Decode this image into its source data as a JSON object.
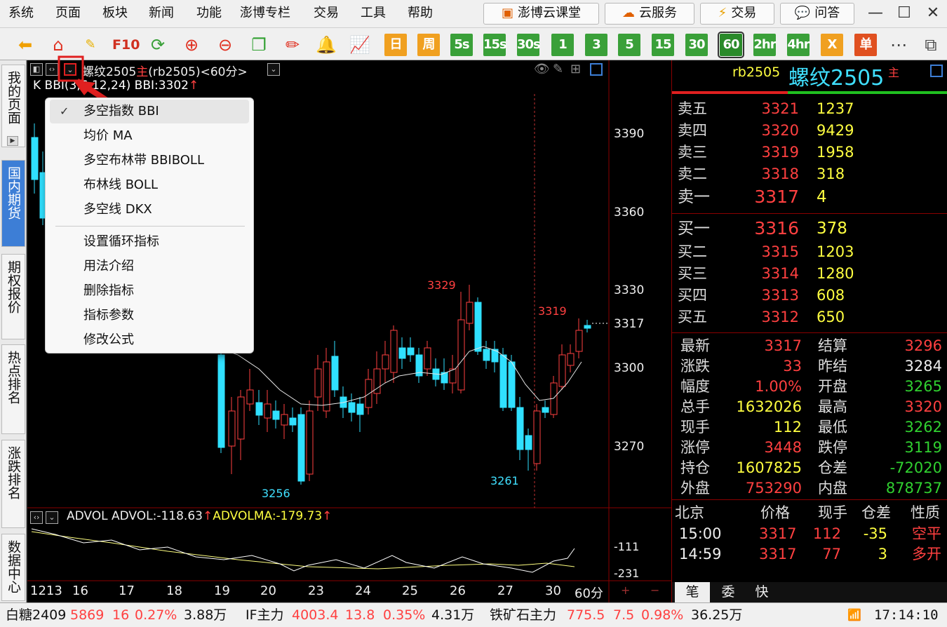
{
  "menubar": {
    "items": [
      "系统",
      "页面",
      "板块",
      "新闻",
      "功能",
      "澎博专栏",
      "交易",
      "工具",
      "帮助"
    ],
    "buttons": [
      "澎博云课堂",
      "云服务",
      "交易",
      "问答"
    ]
  },
  "toolbar": {
    "periods": [
      "日",
      "周",
      "5s",
      "15s",
      "30s",
      "1",
      "3",
      "5",
      "15",
      "30",
      "60",
      "2hr",
      "4hr",
      "X",
      "单"
    ],
    "f10": "F10"
  },
  "left_tabs": [
    "我的页面",
    "国内期货",
    "期权报价",
    "热点排名",
    "涨跌排名",
    "数据中心"
  ],
  "chart": {
    "title": "螺纹2505",
    "main_mark": "主",
    "code": "(rb2505)",
    "period": "<60分>",
    "indicator_line_prefix": "K BBI(3,6,12,24) BBI:3302",
    "indicator_arrow": "↑",
    "price_ticks": [
      "3390",
      "3360",
      "3330",
      "3300",
      "3270"
    ],
    "current_price_tick": "3317",
    "annotations": {
      "high": "3329",
      "high2": "3319",
      "low1": "3256",
      "low2": "3261"
    },
    "date_labels": [
      "1213",
      "16",
      "17",
      "18",
      "19",
      "20",
      "23",
      "24",
      "25",
      "26",
      "27",
      "30"
    ],
    "period_label": "60分",
    "sub_panel": {
      "label_a": "ADVOL ADVOL:-118.63",
      "arrow_a": "↑",
      "label_b": "ADVOLMA:-179.73",
      "arrow_b": "↑",
      "ticks": [
        "-111",
        "-231"
      ]
    }
  },
  "dropdown": {
    "items": [
      "多空指数 BBI",
      "均价 MA",
      "多空布林带 BBIBOLL",
      "布林线 BOLL",
      "多空线 DKX"
    ],
    "items2": [
      "设置循环指标",
      "用法介绍",
      "删除指标",
      "指标参数",
      "修改公式"
    ],
    "check": "✓"
  },
  "quote": {
    "code": "rb2505",
    "name": "螺纹2505",
    "main_mark": "主",
    "asks": [
      {
        "label": "卖五",
        "price": "3321",
        "vol": "1237"
      },
      {
        "label": "卖四",
        "price": "3320",
        "vol": "9429"
      },
      {
        "label": "卖三",
        "price": "3319",
        "vol": "1958"
      },
      {
        "label": "卖二",
        "price": "3318",
        "vol": "318"
      },
      {
        "label": "卖一",
        "price": "3317",
        "vol": "4"
      }
    ],
    "bids": [
      {
        "label": "买一",
        "price": "3316",
        "vol": "378"
      },
      {
        "label": "买二",
        "price": "3315",
        "vol": "1203"
      },
      {
        "label": "买三",
        "price": "3314",
        "vol": "1280"
      },
      {
        "label": "买四",
        "price": "3313",
        "vol": "608"
      },
      {
        "label": "买五",
        "price": "3312",
        "vol": "650"
      }
    ],
    "stats_left": [
      {
        "label": "最新",
        "value": "3317"
      },
      {
        "label": "涨跌",
        "value": "33"
      },
      {
        "label": "幅度",
        "value": "1.00%"
      },
      {
        "label": "总手",
        "value": "1632026"
      },
      {
        "label": "现手",
        "value": "112"
      },
      {
        "label": "涨停",
        "value": "3448"
      },
      {
        "label": "持仓",
        "value": "1607825"
      },
      {
        "label": "外盘",
        "value": "753290"
      }
    ],
    "stats_right": [
      {
        "label": "结算",
        "value": "3296"
      },
      {
        "label": "昨结",
        "value": "3284"
      },
      {
        "label": "开盘",
        "value": "3265"
      },
      {
        "label": "最高",
        "value": "3320"
      },
      {
        "label": "最低",
        "value": "3262"
      },
      {
        "label": "跌停",
        "value": "3119"
      },
      {
        "label": "仓差",
        "value": "-72020"
      },
      {
        "label": "内盘",
        "value": "878737"
      }
    ],
    "ticks_header": [
      "北京",
      "价格",
      "现手",
      "仓差",
      "性质"
    ],
    "ticks": [
      {
        "time": "15:00",
        "price": "3317",
        "vol": "112",
        "oi": "-35",
        "nature": "空平"
      },
      {
        "time": "14:59",
        "price": "3317",
        "vol": "77",
        "oi": "3",
        "nature": "多开"
      }
    ],
    "bottom_tabs": [
      "笔",
      "委",
      "快"
    ]
  },
  "statusbar": {
    "items": [
      {
        "name": "白糖2409",
        "price": "5869",
        "chg": "16",
        "pct": "0.27%",
        "vol": "3.88万"
      },
      {
        "name": "IF主力",
        "price": "4003.4",
        "chg": "13.8",
        "pct": "0.35%",
        "vol": "4.31万"
      },
      {
        "name": "铁矿石主力",
        "price": "775.5",
        "chg": "7.5",
        "pct": "0.98%",
        "vol": "36.25万"
      }
    ],
    "time": "17:14:10"
  },
  "colors": {
    "up": "#ff4040",
    "down": "#30e0ff",
    "accent": "#3d7ed6"
  }
}
